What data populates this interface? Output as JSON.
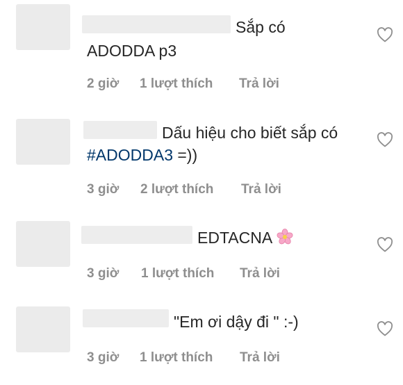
{
  "comments": [
    {
      "text_line1": "Sắp có",
      "text_line2": "ADODDA p3",
      "time": "2 giờ",
      "likes": "1 lượt thích",
      "reply": "Trả lời"
    },
    {
      "text_line1": "Dấu hiệu cho biết sắp có",
      "hashtag": "#ADODDA3",
      "text_line2_rest": " =))",
      "time": "3 giờ",
      "likes": "2 lượt thích",
      "reply": "Trả lời"
    },
    {
      "text_line1": "EDTACNA",
      "emoji": "flower-emoji",
      "time": "3 giờ",
      "likes": "1 lượt thích",
      "reply": "Trả lời"
    },
    {
      "text_line1": "\"Em ơi dậy đi \" :-)",
      "time": "3 giờ",
      "likes": "1 lượt thích",
      "reply": "Trả lời"
    }
  ],
  "icons": {
    "like": "heart-icon"
  },
  "colors": {
    "meta": "#8e8e8e",
    "hashtag": "#00376b",
    "placeholder": "#ededed"
  }
}
